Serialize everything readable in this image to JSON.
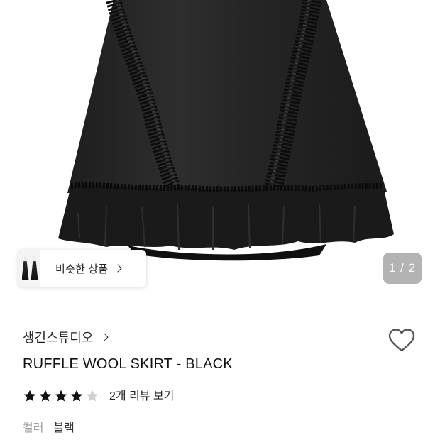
{
  "gallery": {
    "similar_label": "비슷한 상품",
    "counter": "1 / 2"
  },
  "product": {
    "brand": "생긴스튜디오",
    "title": "RUFFLE WOOL SKIRT - BLACK",
    "rating": {
      "value": 4,
      "max": 5
    },
    "review_link": "2개 리뷰 보기",
    "option_label": "컬러",
    "option_value": "블랙"
  },
  "icons": {
    "similar_chevron": "chevron-right-icon",
    "brand_chevron": "chevron-right-icon",
    "wishlist": "heart-outline-icon",
    "star": "star-icon"
  },
  "colors": {
    "star_filled": "#111111",
    "star_empty": "#d0d0d0",
    "counter_bg": "#b3b3b3"
  }
}
